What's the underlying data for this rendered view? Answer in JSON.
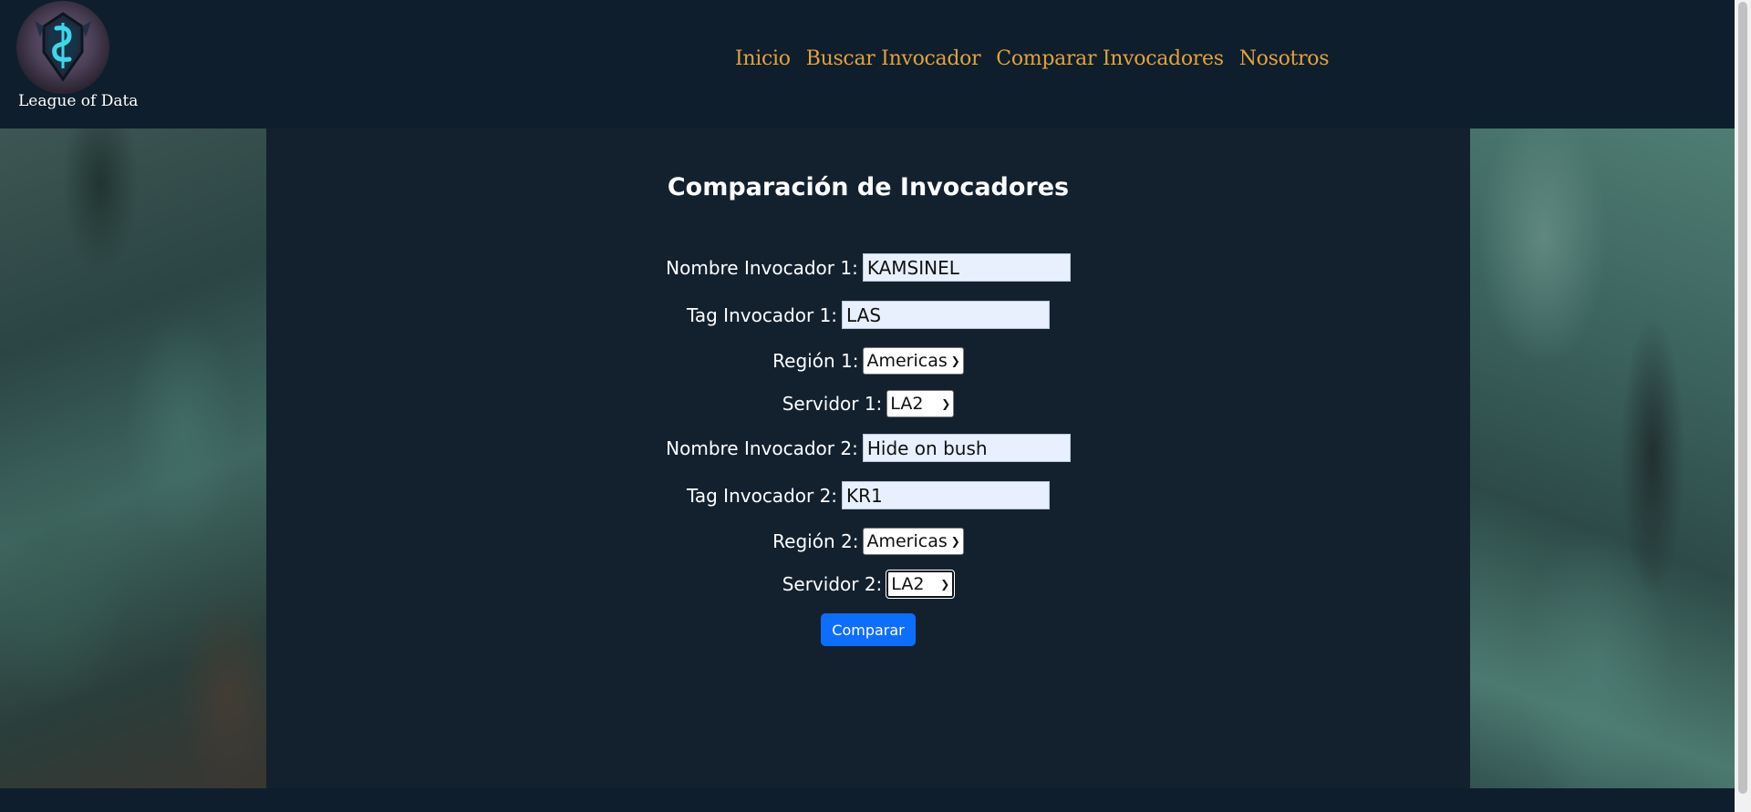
{
  "brand": {
    "name": "League of Data"
  },
  "nav": [
    {
      "label": "Inicio"
    },
    {
      "label": "Buscar Invocador"
    },
    {
      "label": "Comparar Invocadores"
    },
    {
      "label": "Nosotros"
    }
  ],
  "page": {
    "title": "Comparación de Invocadores"
  },
  "form": {
    "name1_label": "Nombre Invocador 1:",
    "name1_value": "KAMSINEL",
    "tag1_label": "Tag Invocador 1:",
    "tag1_value": "LAS",
    "region1_label": "Región 1:",
    "region1_value": "Americas",
    "server1_label": "Servidor 1:",
    "server1_value": "LA2",
    "name2_label": "Nombre Invocador 2:",
    "name2_value": "Hide on bush",
    "tag2_label": "Tag Invocador 2:",
    "tag2_value": "KR1",
    "region2_label": "Región 2:",
    "region2_value": "Americas",
    "server2_label": "Servidor 2:",
    "server2_value": "LA2",
    "submit_label": "Comparar"
  },
  "colors": {
    "header_bg": "#0e1e2c",
    "nav_link": "#e2a23a",
    "button": "#0d6efd",
    "input_bg": "#e8f0fe"
  }
}
